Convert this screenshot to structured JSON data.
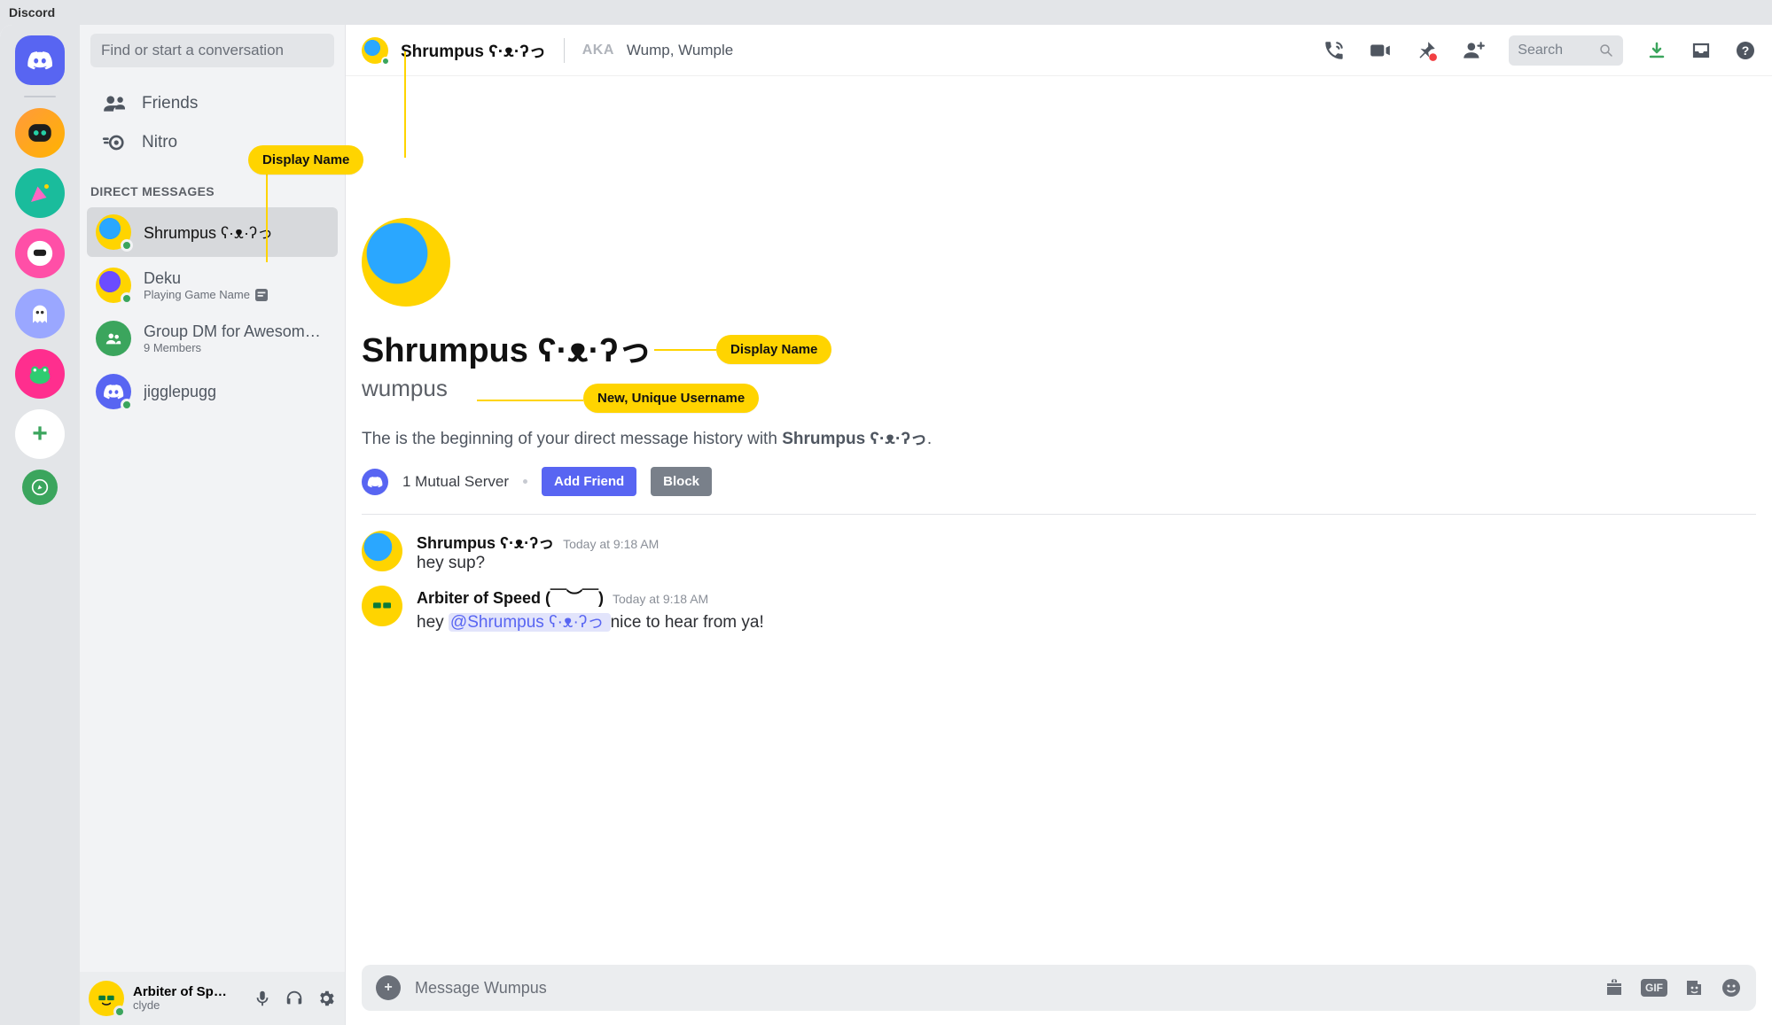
{
  "window": {
    "title": "Discord"
  },
  "sidebar": {
    "search_placeholder": "Find or start a conversation",
    "friends_label": "Friends",
    "nitro_label": "Nitro",
    "section_header": "DIRECT MESSAGES",
    "dms": [
      {
        "name": "Shrumpus ʕ·ᴥ·ʔっ",
        "sub": "",
        "active": true,
        "avatar": "gold-blue"
      },
      {
        "name": "Deku",
        "sub": "Playing Game Name",
        "rich": true,
        "avatar": "gold-blue"
      },
      {
        "name": "Group DM for Awesom…",
        "sub": "9 Members",
        "avatar": "green"
      },
      {
        "name": "jigglepugg",
        "sub": "",
        "avatar": "blurple"
      }
    ]
  },
  "user_footer": {
    "display_name": "Arbiter of Sp…",
    "username": "clyde",
    "avatar": "sunglasses"
  },
  "header": {
    "title": "Shrumpus ʕ·ᴥ·ʔっ",
    "aka_label": "AKA",
    "aka_value": "Wump, Wumple",
    "search_placeholder": "Search"
  },
  "profile": {
    "display_name": "Shrumpus ʕ·ᴥ·ʔっ",
    "username": "wumpus",
    "beginning_prefix": "The is the beginning of your direct message history with ",
    "beginning_name": "Shrumpus ʕ·ᴥ·ʔっ",
    "beginning_suffix": ".",
    "mutual": "1 Mutual Server",
    "add_friend": "Add Friend",
    "block": "Block"
  },
  "messages": [
    {
      "author": "Shrumpus ʕ·ᴥ·ʔっ",
      "time": "Today at 9:18 AM",
      "body_plain": "hey sup?",
      "avatar": "gold-blue"
    },
    {
      "author": "Arbiter of Speed (￣︶￣)",
      "time": "Today at 9:18 AM",
      "body_prefix": "hey ",
      "mention": "@Shrumpus ʕ·ᴥ·ʔっ ",
      "body_suffix": "nice to hear from ya!",
      "avatar": "sunglasses"
    }
  ],
  "composer": {
    "placeholder": "Message Wumpus"
  },
  "annotations": {
    "display_name_top": "Display Name",
    "display_name_profile": "Display Name",
    "username": "New, Unique Username"
  }
}
